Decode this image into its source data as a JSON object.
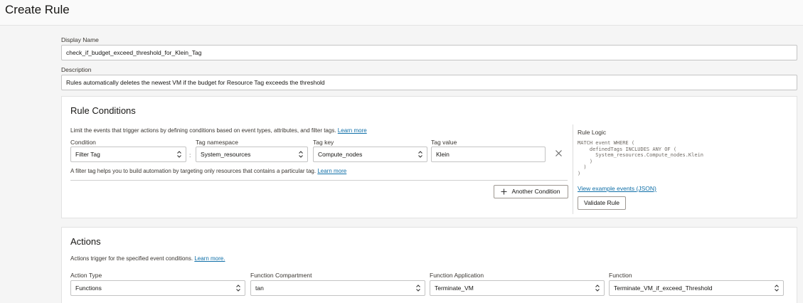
{
  "page": {
    "title": "Create Rule"
  },
  "form": {
    "display_name_label": "Display Name",
    "display_name_value": "check_if_budget_exceed_threshold_for_Klein_Tag",
    "description_label": "Description",
    "description_value": "Rules automatically deletes the newest VM if the budget for Resource Tag exceeds the threshold"
  },
  "rule_conditions": {
    "title": "Rule Conditions",
    "help_text": "Limit the events that trigger actions by defining conditions based on event types, attributes, and filter tags.",
    "help_link": "Learn more",
    "condition_label": "Condition",
    "condition_value": "Filter Tag",
    "tag_namespace_label": "Tag namespace",
    "tag_namespace_value": "System_resources",
    "separator": ":",
    "tag_key_label": "Tag key",
    "tag_key_value": "Compute_nodes",
    "tag_value_label": "Tag value",
    "tag_value_value": "Klein",
    "filter_help_text": "A filter tag helps you to build automation by targeting only resources that contains a particular tag.",
    "filter_help_link": "Learn more",
    "another_condition_button": "Another Condition",
    "rule_logic_title": "Rule Logic",
    "rule_logic_lines": [
      "MATCH event WHERE (",
      "    definedTags INCLUDES ANY OF (",
      "      System_resources.Compute_nodes.Klein",
      "    )",
      "  )",
      ")"
    ],
    "view_example_link": "View example events (JSON)",
    "validate_button": "Validate Rule"
  },
  "actions": {
    "title": "Actions",
    "help_text": "Actions trigger for the specified event conditions.",
    "help_link": "Learn more.",
    "action_type_label": "Action Type",
    "action_type_value": "Functions",
    "function_compartment_label": "Function Compartment",
    "function_compartment_value": "tan",
    "function_application_label": "Function Application",
    "function_application_value": "Terminate_VM",
    "function_label": "Function",
    "function_value": "Terminate_VM_if_exceed_Threshold"
  },
  "icons": {
    "select_chevron": "chevron-up-down-icon",
    "remove": "close-icon",
    "add": "plus-icon"
  },
  "colors": {
    "link": "#0f6fa8",
    "border": "#c4c4c4",
    "background": "#f5f5f5"
  }
}
